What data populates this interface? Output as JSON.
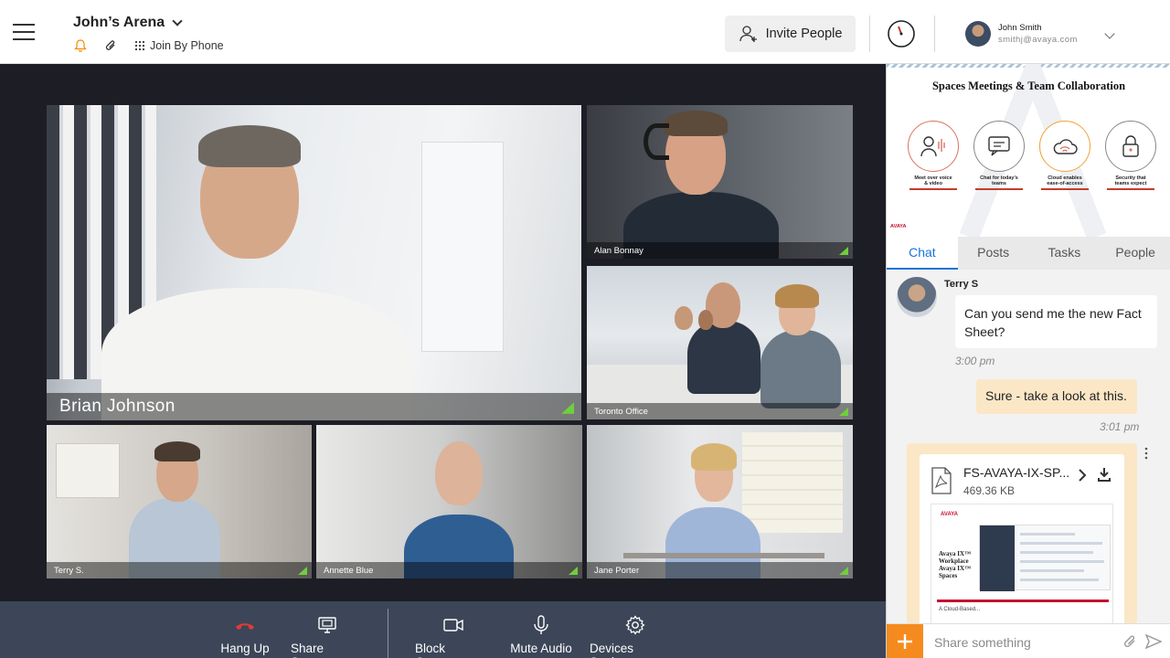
{
  "header": {
    "menu_icon": "hamburger-icon",
    "room_title": "John’s Arena",
    "room_menu_icon": "chevron-down-icon",
    "notify_icon": "bell-icon",
    "attach_icon": "paperclip-icon",
    "join_by_phone": "Join By Phone",
    "invite_label": "Invite People",
    "invite_icon": "add-person-icon",
    "timer_icon": "timer-icon",
    "user": {
      "name": "John Smith",
      "email": "smithj@avaya.com"
    },
    "colors": {
      "accent": "#f28c00"
    }
  },
  "stage": {
    "background": "#1d1d26",
    "participants": [
      {
        "name": "Brian Johnson"
      },
      {
        "name": "Alan Bonnay"
      },
      {
        "name": "Toronto Office"
      },
      {
        "name": "Terry S."
      },
      {
        "name": "Annette Blue"
      },
      {
        "name": "Jane Porter"
      }
    ]
  },
  "controls": {
    "hang_up": "Hang Up",
    "share_screen": "Share Screen",
    "block_camera": "Block Camera",
    "mute_audio": "Mute Audio",
    "device_settings": "Devices Settings",
    "colors": {
      "bar": "#3c4658",
      "hangup": "#e53935"
    }
  },
  "panel": {
    "banner": {
      "title": "Spaces Meetings & Team Collaboration",
      "features": [
        {
          "icon": "voice-video-icon",
          "caption_1": "Meet over voice",
          "caption_2": "& video"
        },
        {
          "icon": "chat-icon",
          "caption_1": "Chat for today’s",
          "caption_2": "teams"
        },
        {
          "icon": "cloud-icon",
          "caption_1": "Cloud enables",
          "caption_2": "ease-of-access"
        },
        {
          "icon": "lock-icon",
          "caption_1": "Security that",
          "caption_2": "teams expect"
        }
      ],
      "brand": "AVAYA"
    },
    "tabs": [
      "Chat",
      "Posts",
      "Tasks",
      "People"
    ],
    "active_tab": "Chat",
    "messages": [
      {
        "sender": "Terry S",
        "text": "Can you send me the new Fact Sheet?",
        "time": "3:00 pm"
      },
      {
        "text": "Sure - take a look at this.",
        "time": "3:01 pm"
      }
    ],
    "file": {
      "name": "FS-AVAYA-IX-SP...",
      "size": "469.36 KB",
      "preview": {
        "brand": "AVAYA",
        "title": "Avaya IX™ Workplace",
        "subtitle": "Avaya IX™ Spaces",
        "body": "A Cloud-Based..."
      }
    },
    "composer": {
      "placeholder": "Share something"
    },
    "colors": {
      "active_tab": "#1a73d9",
      "outgoing_bubble": "#fbe7c6",
      "plus_button": "#f58b1f"
    }
  }
}
